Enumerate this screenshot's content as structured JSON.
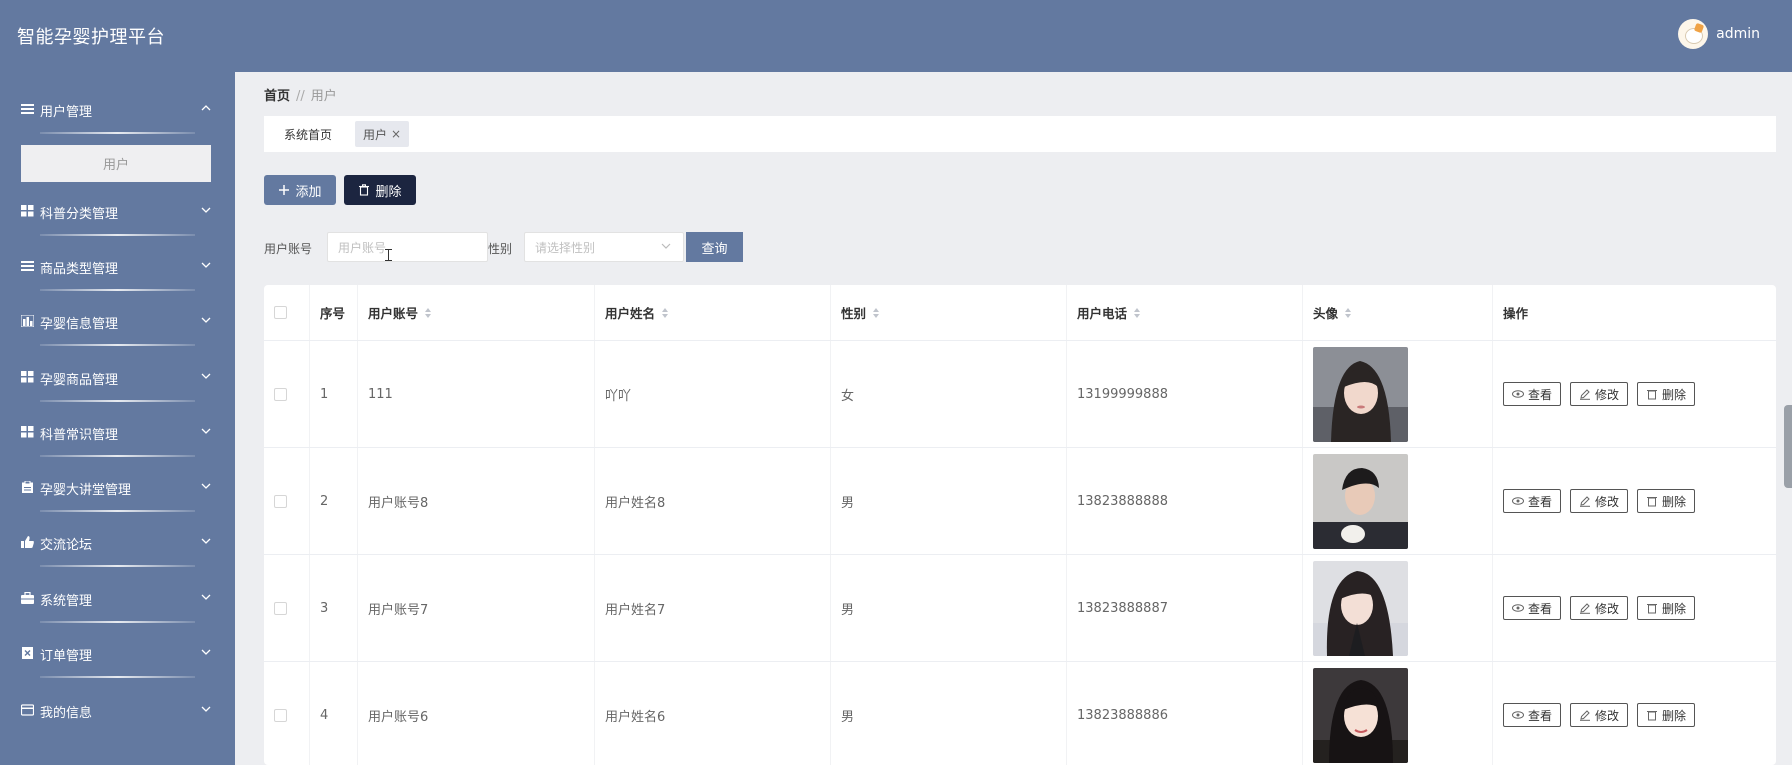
{
  "header": {
    "title": "智能孕婴护理平台",
    "user": "admin"
  },
  "sidebar": {
    "items": [
      {
        "label": "用户管理",
        "icon": "list-icon",
        "expanded": true,
        "sub": [
          "用户"
        ]
      },
      {
        "label": "科普分类管理",
        "icon": "grid-icon"
      },
      {
        "label": "商品类型管理",
        "icon": "list-icon"
      },
      {
        "label": "孕婴信息管理",
        "icon": "chart-icon"
      },
      {
        "label": "孕婴商品管理",
        "icon": "grid-icon"
      },
      {
        "label": "科普常识管理",
        "icon": "grid-icon"
      },
      {
        "label": "孕婴大讲堂管理",
        "icon": "clipboard-icon"
      },
      {
        "label": "交流论坛",
        "icon": "thumbs-up-icon"
      },
      {
        "label": "系统管理",
        "icon": "briefcase-icon"
      },
      {
        "label": "订单管理",
        "icon": "cancel-doc-icon"
      },
      {
        "label": "我的信息",
        "icon": "card-icon"
      }
    ]
  },
  "breadcrumb": {
    "home": "首页",
    "sep": "//",
    "current": "用户"
  },
  "tabs": {
    "home": "系统首页",
    "active": "用户",
    "close": "×"
  },
  "toolbar": {
    "add_label": "添加",
    "delete_label": "删除"
  },
  "search": {
    "account_label": "用户账号",
    "account_placeholder": "用户账号",
    "gender_label": "性别",
    "gender_placeholder": "请选择性别",
    "query_label": "查询"
  },
  "table": {
    "headers": {
      "index": "序号",
      "account": "用户账号",
      "name": "用户姓名",
      "gender": "性别",
      "phone": "用户电话",
      "avatar": "头像",
      "ops": "操作"
    },
    "rows": [
      {
        "index": "1",
        "account": "111",
        "name": "吖吖",
        "gender": "女",
        "phone": "13199999888"
      },
      {
        "index": "2",
        "account": "用户账号8",
        "name": "用户姓名8",
        "gender": "男",
        "phone": "13823888888"
      },
      {
        "index": "3",
        "account": "用户账号7",
        "name": "用户姓名7",
        "gender": "男",
        "phone": "13823888887"
      },
      {
        "index": "4",
        "account": "用户账号6",
        "name": "用户姓名6",
        "gender": "男",
        "phone": "13823888886"
      }
    ],
    "actions": {
      "view": "查看",
      "edit": "修改",
      "delete": "删除"
    }
  },
  "colors": {
    "primary": "#6379a0",
    "dark_button": "#1c2540",
    "background": "#edeef1"
  }
}
